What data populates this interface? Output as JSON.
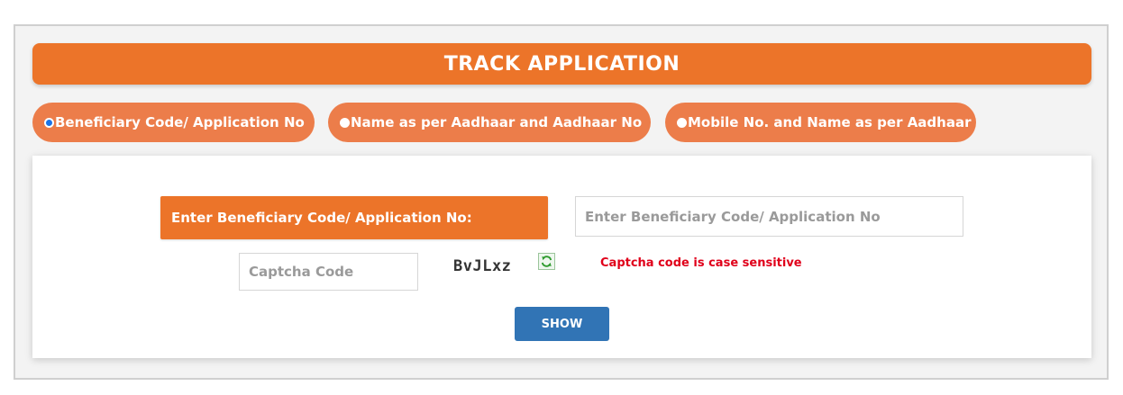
{
  "header": {
    "title": "TRACK APPLICATION"
  },
  "search_options": [
    {
      "label": "Beneficiary Code/ Application No",
      "selected": true
    },
    {
      "label": "Name as per Aadhaar and Aadhaar No",
      "selected": false
    },
    {
      "label": "Mobile No. and Name as per Aadhaar",
      "selected": false
    }
  ],
  "form": {
    "field_label": "Enter Beneficiary Code/ Application No:",
    "application_placeholder": "Enter Beneficiary Code/ Application No",
    "application_value": "",
    "captcha_placeholder": "Captcha Code",
    "captcha_value": "",
    "captcha_image_text": "BvJLxz",
    "refresh_icon": "refresh-icon",
    "captcha_hint": "Captcha code is case sensitive",
    "show_label": "SHOW"
  },
  "colors": {
    "accent_orange": "#ec7429",
    "pill_orange": "#ec7d4a",
    "button_blue": "#3174b5",
    "hint_red": "#e0001a"
  }
}
